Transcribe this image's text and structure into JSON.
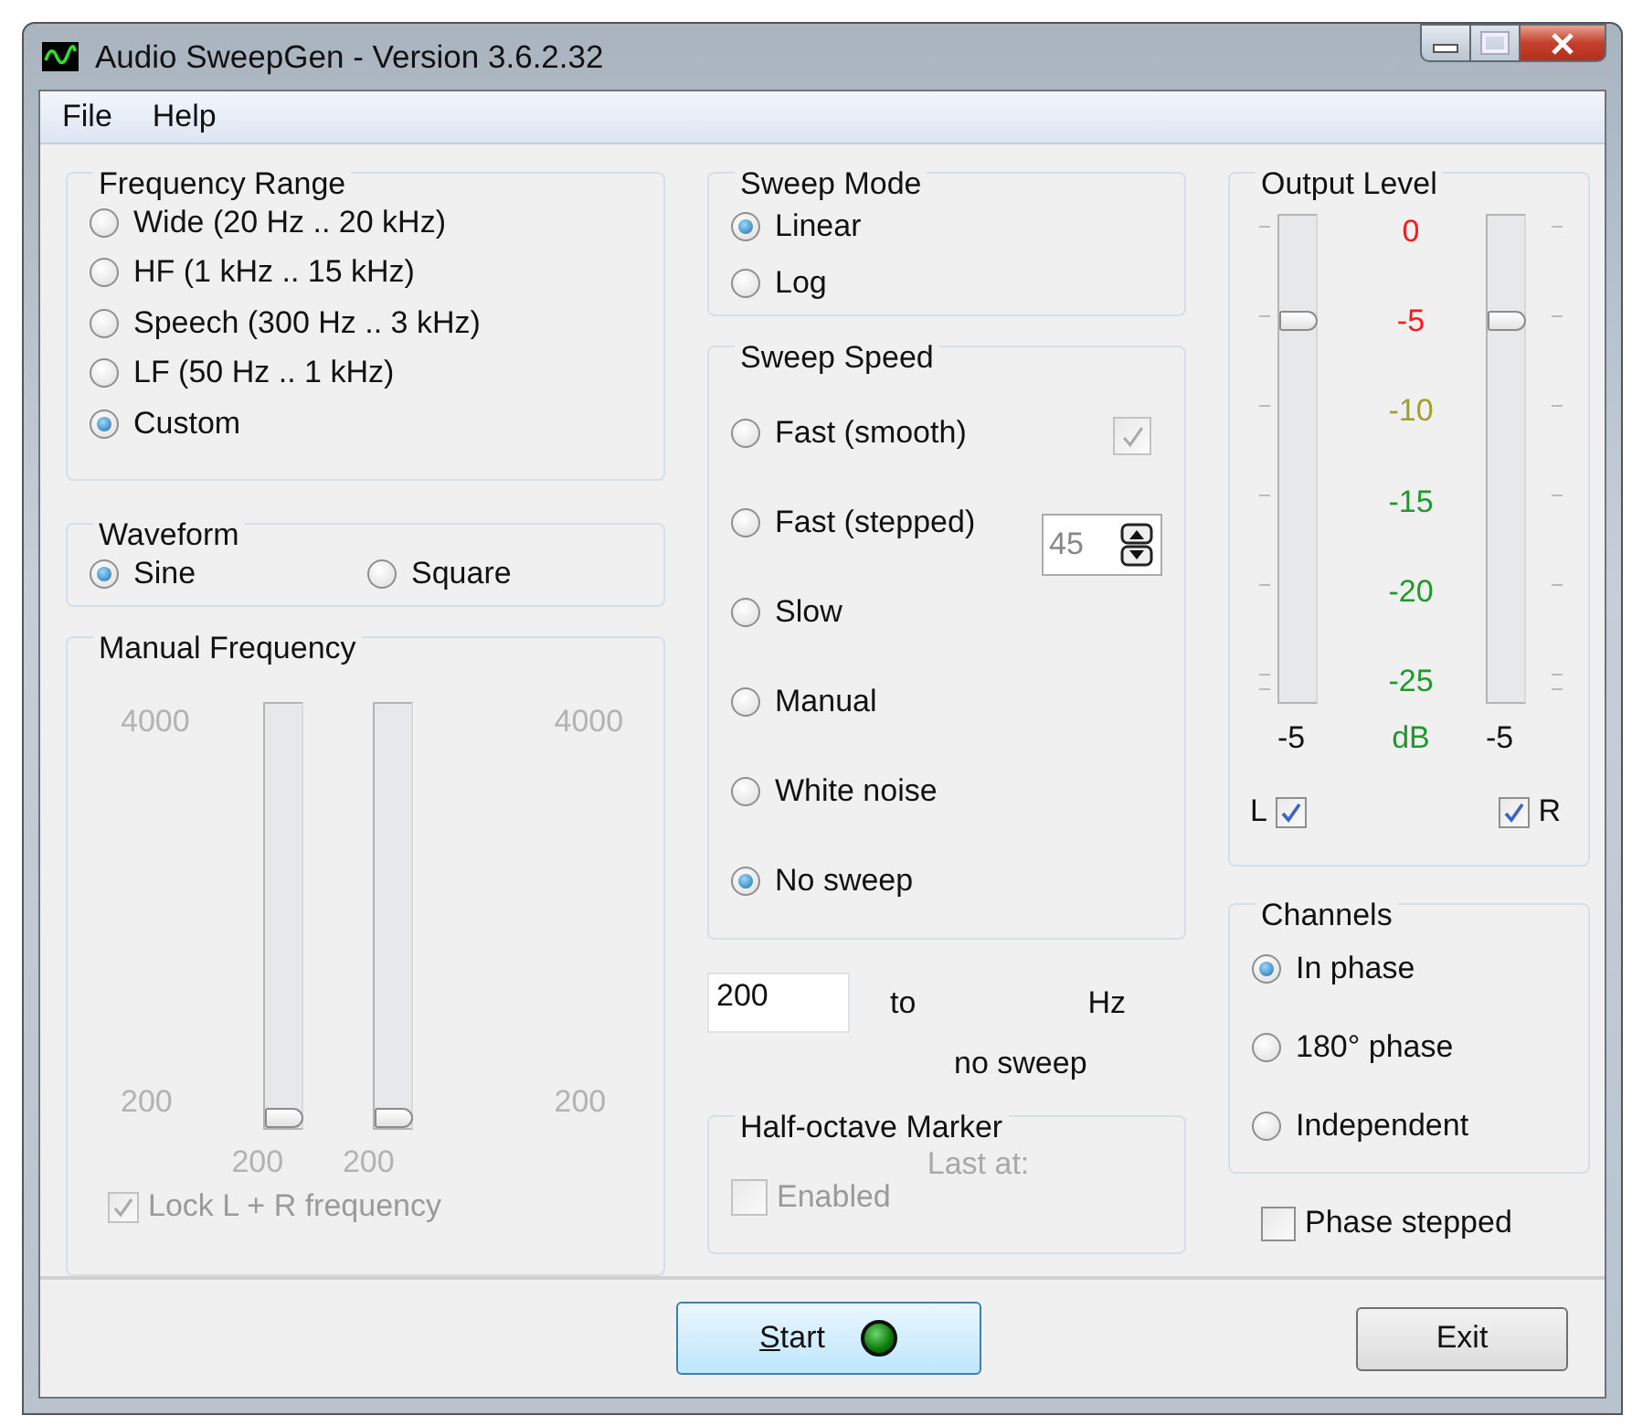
{
  "window": {
    "title": "Audio SweepGen - Version 3.6.2.32"
  },
  "menu": [
    "File",
    "Help"
  ],
  "frequency_range": {
    "title": "Frequency Range",
    "options": [
      {
        "label": "Wide  (20 Hz .. 20 kHz)",
        "selected": false
      },
      {
        "label": "HF  (1 kHz .. 15 kHz)",
        "selected": false
      },
      {
        "label": "Speech  (300 Hz .. 3 kHz)",
        "selected": false
      },
      {
        "label": "LF  (50 Hz .. 1 kHz)",
        "selected": false
      },
      {
        "label": "Custom",
        "selected": true
      }
    ]
  },
  "waveform": {
    "title": "Waveform",
    "options": [
      {
        "label": "Sine",
        "selected": true
      },
      {
        "label": "Square",
        "selected": false
      }
    ]
  },
  "manual_frequency": {
    "title": "Manual Frequency",
    "disabled": true,
    "left_max": "4000",
    "left_min": "200",
    "right_max": "4000",
    "right_min": "200",
    "sliders": [
      {
        "level": 0,
        "reading": "200"
      },
      {
        "level": 0,
        "reading": "200"
      }
    ],
    "lock": {
      "label": "Lock L + R frequency",
      "checked": true,
      "disabled": true
    }
  },
  "sweep_mode": {
    "title": "Sweep Mode",
    "options": [
      {
        "label": "Linear",
        "selected": true
      },
      {
        "label": "Log",
        "selected": false
      }
    ]
  },
  "sweep_speed": {
    "title": "Sweep Speed",
    "options": [
      {
        "label": "Fast (smooth)",
        "selected": false
      },
      {
        "label": "Fast (stepped)",
        "selected": false
      },
      {
        "label": "Slow",
        "selected": false
      },
      {
        "label": "Manual",
        "selected": false
      },
      {
        "label": "White noise",
        "selected": false
      },
      {
        "label": "No sweep",
        "selected": true
      }
    ],
    "smooth_check": {
      "checked": true,
      "disabled": true
    },
    "step_spinner": {
      "value": "45",
      "disabled": true
    }
  },
  "range": {
    "from": "200",
    "to_label": "to",
    "unit": "Hz",
    "status": "no sweep"
  },
  "half_octave_marker": {
    "title": "Half-octave Marker",
    "enabled": {
      "label": "Enabled",
      "checked": false,
      "disabled": true
    },
    "last_at": "Last at:"
  },
  "output_level": {
    "title": "Output Level",
    "unit": "dB",
    "scale": [
      {
        "label": "0",
        "color": "#ff1a1a"
      },
      {
        "label": "-5",
        "color": "#ff1a1a"
      },
      {
        "label": "-10",
        "color": "#a0a030"
      },
      {
        "label": "-15",
        "color": "#1e9a2a"
      },
      {
        "label": "-20",
        "color": "#1e9a2a"
      },
      {
        "label": "-25",
        "color": "#1e9a2a"
      }
    ],
    "channels": [
      {
        "label": "L",
        "level": 0.8,
        "reading": "-5",
        "checked": true
      },
      {
        "label": "R",
        "level": 0.8,
        "reading": "-5",
        "checked": true
      }
    ]
  },
  "channels": {
    "title": "Channels",
    "options": [
      {
        "label": "In phase",
        "selected": true
      },
      {
        "label": "180° phase",
        "selected": false
      },
      {
        "label": "Independent",
        "selected": false
      }
    ]
  },
  "phase_stepped": {
    "label": "Phase stepped",
    "checked": false
  },
  "buttons": {
    "start": "Start",
    "exit": "Exit"
  }
}
